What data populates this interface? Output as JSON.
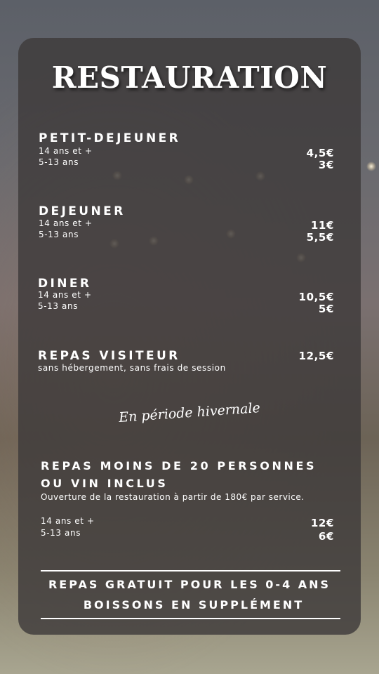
{
  "title": "RESTAURATION",
  "sections": [
    {
      "name": "PETIT-DEJEUNER",
      "line1": "14 ans et +",
      "line2": "5-13 ans",
      "price1": "4,5€",
      "price2": "3€"
    },
    {
      "name": "DEJEUNER",
      "line1": "14 ans et +",
      "line2": "5-13 ans",
      "price1": "11€",
      "price2": "5,5€"
    },
    {
      "name": "DINER",
      "line1": "14 ans et +",
      "line2": "5-13 ans",
      "price1": "10,5€",
      "price2": "5€"
    }
  ],
  "visiteur": {
    "name": "REPAS VISITEUR",
    "subtitle": "sans hébergement, sans frais de session",
    "price": "12,5€"
  },
  "winter_label": "En période hivernale",
  "winter": {
    "name_line1": "REPAS MOINS DE 20 PERSONNES",
    "name_line2": "OU VIN INCLUS",
    "subtitle": "Ouverture de la restauration à partir de 180€ par service.",
    "line1": "14 ans et +",
    "line2": "5-13 ans",
    "price1": "12€",
    "price2": "6€"
  },
  "footer": {
    "line1": "REPAS GRATUIT POUR LES 0-4 ANS",
    "line2": "BOISSONS EN SUPPLÉMENT"
  }
}
